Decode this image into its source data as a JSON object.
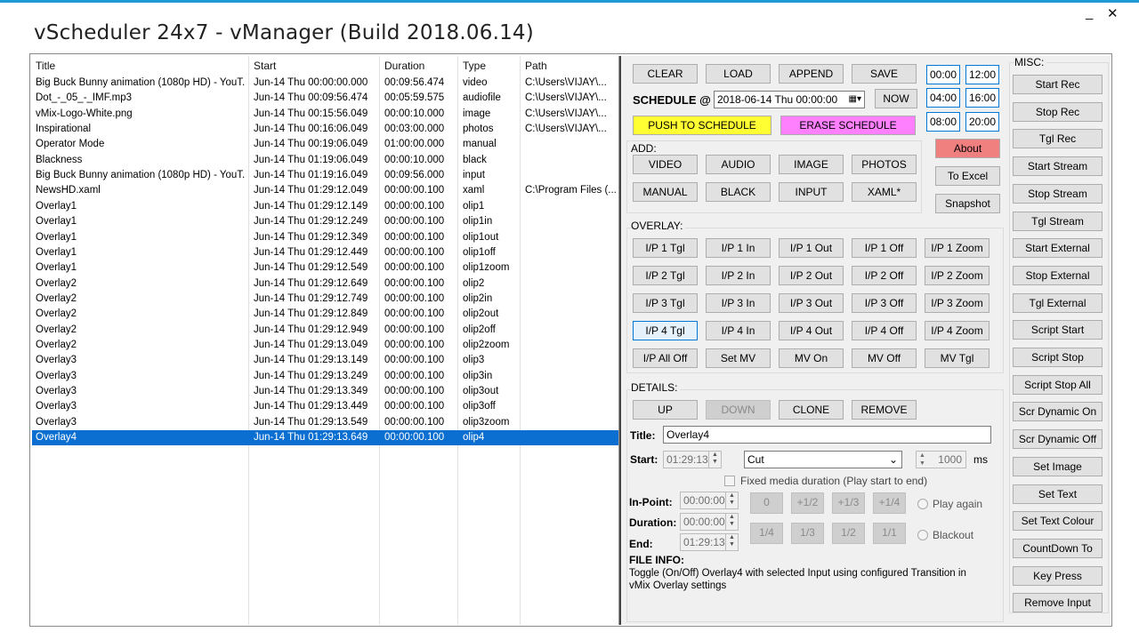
{
  "window": {
    "title": "vScheduler 24x7 - vManager (Build 2018.06.14)",
    "minimize": "_",
    "close": "✕"
  },
  "grid": {
    "headers": [
      "Title",
      "Start",
      "Duration",
      "Type",
      "Path"
    ],
    "rows": [
      [
        "Big Buck Bunny animation (1080p HD) - YouT...",
        "Jun-14 Thu  00:00:00.000",
        "00:09:56.474",
        "video",
        "C:\\Users\\VIJAY\\..."
      ],
      [
        "Dot_-_05_-_IMF.mp3",
        "Jun-14 Thu  00:09:56.474",
        "00:05:59.575",
        "audiofile",
        "C:\\Users\\VIJAY\\..."
      ],
      [
        "vMix-Logo-White.png",
        "Jun-14 Thu  00:15:56.049",
        "00:00:10.000",
        "image",
        "C:\\Users\\VIJAY\\..."
      ],
      [
        "Inspirational",
        "Jun-14 Thu  00:16:06.049",
        "00:03:00.000",
        "photos",
        "C:\\Users\\VIJAY\\..."
      ],
      [
        "Operator Mode",
        "Jun-14 Thu  00:19:06.049",
        "01:00:00.000",
        "manual",
        ""
      ],
      [
        "Blackness",
        "Jun-14 Thu  01:19:06.049",
        "00:00:10.000",
        "black",
        ""
      ],
      [
        "Big Buck Bunny animation (1080p HD) - YouT...",
        "Jun-14 Thu  01:19:16.049",
        "00:09:56.000",
        "input",
        ""
      ],
      [
        "NewsHD.xaml",
        "Jun-14 Thu  01:29:12.049",
        "00:00:00.100",
        "xaml",
        "C:\\Program Files (..."
      ],
      [
        "Overlay1",
        "Jun-14 Thu  01:29:12.149",
        "00:00:00.100",
        "olip1",
        ""
      ],
      [
        "Overlay1",
        "Jun-14 Thu  01:29:12.249",
        "00:00:00.100",
        "olip1in",
        ""
      ],
      [
        "Overlay1",
        "Jun-14 Thu  01:29:12.349",
        "00:00:00.100",
        "olip1out",
        ""
      ],
      [
        "Overlay1",
        "Jun-14 Thu  01:29:12.449",
        "00:00:00.100",
        "olip1off",
        ""
      ],
      [
        "Overlay1",
        "Jun-14 Thu  01:29:12.549",
        "00:00:00.100",
        "olip1zoom",
        ""
      ],
      [
        "Overlay2",
        "Jun-14 Thu  01:29:12.649",
        "00:00:00.100",
        "olip2",
        ""
      ],
      [
        "Overlay2",
        "Jun-14 Thu  01:29:12.749",
        "00:00:00.100",
        "olip2in",
        ""
      ],
      [
        "Overlay2",
        "Jun-14 Thu  01:29:12.849",
        "00:00:00.100",
        "olip2out",
        ""
      ],
      [
        "Overlay2",
        "Jun-14 Thu  01:29:12.949",
        "00:00:00.100",
        "olip2off",
        ""
      ],
      [
        "Overlay2",
        "Jun-14 Thu  01:29:13.049",
        "00:00:00.100",
        "olip2zoom",
        ""
      ],
      [
        "Overlay3",
        "Jun-14 Thu  01:29:13.149",
        "00:00:00.100",
        "olip3",
        ""
      ],
      [
        "Overlay3",
        "Jun-14 Thu  01:29:13.249",
        "00:00:00.100",
        "olip3in",
        ""
      ],
      [
        "Overlay3",
        "Jun-14 Thu  01:29:13.349",
        "00:00:00.100",
        "olip3out",
        ""
      ],
      [
        "Overlay3",
        "Jun-14 Thu  01:29:13.449",
        "00:00:00.100",
        "olip3off",
        ""
      ],
      [
        "Overlay3",
        "Jun-14 Thu  01:29:13.549",
        "00:00:00.100",
        "olip3zoom",
        ""
      ],
      [
        "Overlay4",
        "Jun-14 Thu  01:29:13.649",
        "00:00:00.100",
        "olip4",
        ""
      ]
    ],
    "selected_row": 23
  },
  "top": {
    "clear": "CLEAR",
    "load": "LOAD",
    "append": "APPEND",
    "save": "SAVE",
    "schedule_label": "SCHEDULE @",
    "schedule_value": "2018-06-14  Thu  00:00:00",
    "now": "NOW",
    "push": "PUSH TO SCHEDULE",
    "erase": "ERASE SCHEDULE",
    "times": [
      "00:00",
      "12:00",
      "04:00",
      "16:00",
      "08:00",
      "20:00"
    ]
  },
  "add": {
    "label": "ADD:",
    "video": "VIDEO",
    "audio": "AUDIO",
    "image": "IMAGE",
    "photos": "PHOTOS",
    "manual": "MANUAL",
    "black": "BLACK",
    "input": "INPUT",
    "xaml": "XAML*"
  },
  "side": {
    "about": "About",
    "to_excel": "To Excel",
    "snapshot": "Snapshot"
  },
  "overlay": {
    "label": "OVERLAY:",
    "buttons": [
      [
        "I/P 1 Tgl",
        "I/P 1 In",
        "I/P 1 Out",
        "I/P 1 Off",
        "I/P 1 Zoom"
      ],
      [
        "I/P 2 Tgl",
        "I/P 2 In",
        "I/P 2 Out",
        "I/P 2 Off",
        "I/P 2 Zoom"
      ],
      [
        "I/P 3 Tgl",
        "I/P 3 In",
        "I/P 3 Out",
        "I/P 3 Off",
        "I/P 3 Zoom"
      ],
      [
        "I/P 4 Tgl",
        "I/P 4 In",
        "I/P 4 Out",
        "I/P 4 Off",
        "I/P 4 Zoom"
      ],
      [
        "I/P All Off",
        "Set MV",
        "MV On",
        "MV Off",
        "MV Tgl"
      ]
    ]
  },
  "details": {
    "label": "DETAILS:",
    "up": "UP",
    "down": "DOWN",
    "clone": "CLONE",
    "remove": "REMOVE",
    "title_label": "Title:",
    "title_value": "Overlay4",
    "start_label": "Start:",
    "start_value": "01:29:13",
    "transition": "Cut",
    "ms_value": "1000",
    "ms_label": "ms",
    "fixed_label": "Fixed media duration (Play start to end)",
    "inpoint_label": "In-Point:",
    "inpoint_value": "00:00:00",
    "duration_label": "Duration:",
    "duration_value": "00:00:00",
    "end_label": "End:",
    "end_value": "01:29:13",
    "frac_row1": [
      "0",
      "+1/2",
      "+1/3",
      "+1/4"
    ],
    "frac_row2": [
      "1/4",
      "1/3",
      "1/2",
      "1/1"
    ],
    "play_again": "Play again",
    "blackout": "Blackout",
    "file_info_label": "FILE INFO:",
    "file_info_text": "Toggle (On/Off) Overlay4 with selected Input using configured Transition in vMix Overlay settings"
  },
  "misc": {
    "label": "MISC:",
    "buttons": [
      "Start Rec",
      "Stop Rec",
      "Tgl Rec",
      "Start Stream",
      "Stop Stream",
      "Tgl Stream",
      "Start External",
      "Stop External",
      "Tgl External",
      "Script Start",
      "Script Stop",
      "Script Stop All",
      "Scr Dynamic On",
      "Scr Dynamic Off",
      "Set Image",
      "Set Text",
      "Set Text Colour",
      "CountDown To",
      "Key Press",
      "Remove Input"
    ]
  },
  "colors": {
    "push": "#ffff33",
    "erase": "#ff80ff",
    "about": "#f08080",
    "selection": "#0a6fd1",
    "accent": "#1e9ad6"
  }
}
